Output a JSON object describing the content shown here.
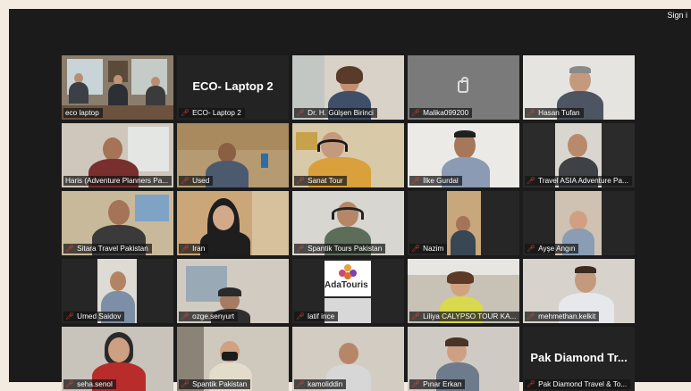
{
  "header": {
    "sign_in": "Sign i"
  },
  "tiles": [
    {
      "name": "eco laptop"
    },
    {
      "name": "ECO- Laptop 2",
      "display": "ECO- Laptop 2"
    },
    {
      "name": "Dr. H. Gülşen Birinci"
    },
    {
      "name": "Malika099200"
    },
    {
      "name": "Hasan Tufan"
    },
    {
      "name": "Haris (Adventure Planners Pa..."
    },
    {
      "name": "Used"
    },
    {
      "name": "Sanat Tour"
    },
    {
      "name": "İlke Gurdal"
    },
    {
      "name": "Travel ASIA Adventure Pa..."
    },
    {
      "name": "Sitara Travel Pakistan"
    },
    {
      "name": "Iran"
    },
    {
      "name": "Spantik Tours Pakistan"
    },
    {
      "name": "Nazim"
    },
    {
      "name": "Ayşe Angın"
    },
    {
      "name": "Umed Saidov"
    },
    {
      "name": "ozge.senyurt"
    },
    {
      "name": "latif ince",
      "logo": "AdaTouris"
    },
    {
      "name": "Liliya CALYPSO TOUR KA..."
    },
    {
      "name": "mehmethan.kelkit"
    },
    {
      "name": "seha.senol"
    },
    {
      "name": "Spantik Pakistan"
    },
    {
      "name": "kamoliddin"
    },
    {
      "name": "Pınar Erkan"
    },
    {
      "name": "Pak Diamond Travel & To...",
      "display": "Pak Diamond Tr..."
    }
  ],
  "colors": {
    "active_speaker_border": "#e8e36a",
    "muted_mic": "#e5443b",
    "window_bg": "#1b1b1b"
  }
}
